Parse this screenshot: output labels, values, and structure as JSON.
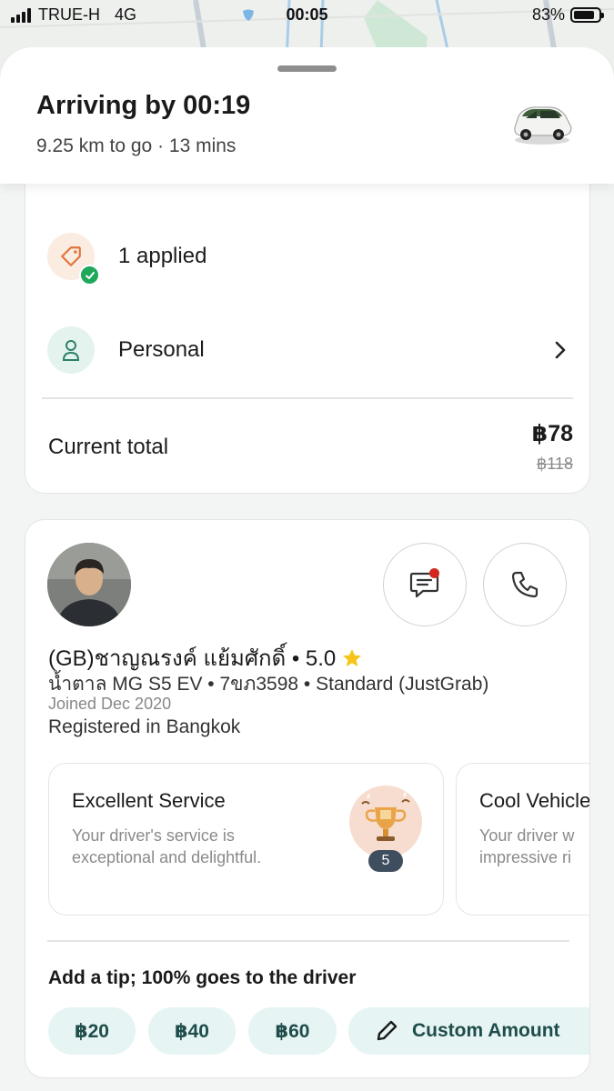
{
  "status_bar": {
    "carrier": "TRUE-H",
    "network": "4G",
    "time": "00:05",
    "battery_percent": "83%",
    "battery_level": 0.83
  },
  "trip": {
    "arrival_title": "Arriving by 00:19",
    "distance_eta": "9.25 km to go · 13 mins"
  },
  "payment": {
    "promo_label": "1 applied",
    "profile_label": "Personal",
    "total_label": "Current total",
    "total_value": "฿78",
    "total_original": "฿118"
  },
  "driver": {
    "name": "(GB)ชาญณรงค์ แย้มศักดิ์ • 5.0",
    "vehicle": "น้ำตาล MG S5 EV • 7ขภ3598 • Standard (JustGrab)",
    "joined": "Joined Dec 2020",
    "registered": "Registered in Bangkok"
  },
  "compliments": [
    {
      "title": "Excellent Service",
      "description": "Your driver's service is exceptional and delightful.",
      "count": "5"
    },
    {
      "title": "Cool Vehicle",
      "description": "Your driver w impressive ri"
    }
  ],
  "tip": {
    "title": "Add a tip; 100% goes to the driver",
    "options": [
      "฿20",
      "฿40",
      "฿60"
    ],
    "custom_label": "Custom Amount"
  },
  "colors": {
    "promo_icon": "#e2743b",
    "check_green": "#1fa85a",
    "tip_pill_bg": "#e6f4f4",
    "tip_text": "#1f4d4a",
    "star": "#f5c518",
    "notification_dot": "#d2261f"
  }
}
